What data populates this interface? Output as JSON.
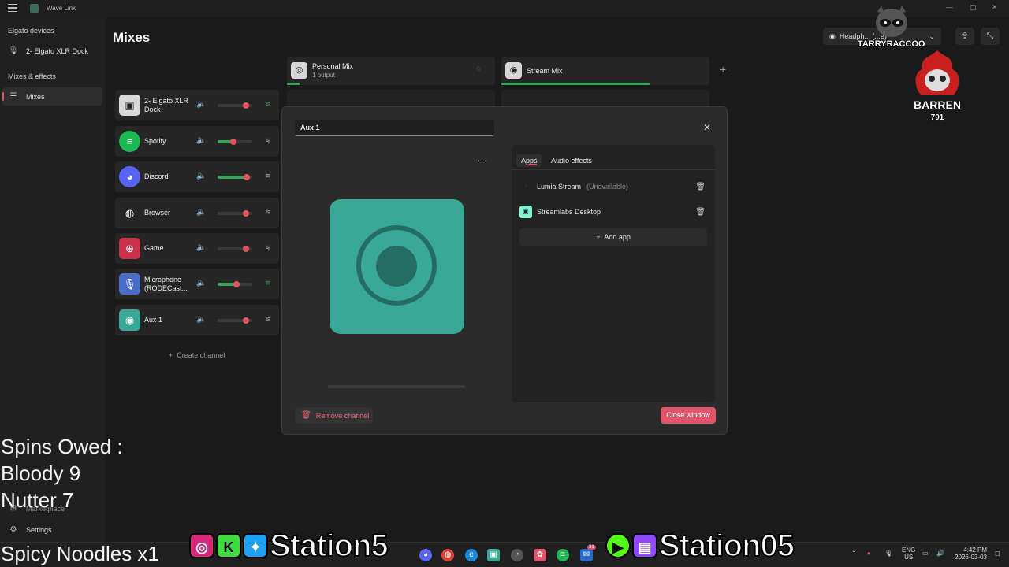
{
  "window": {
    "title": "Wave Link"
  },
  "sidebar": {
    "devices_heading": "Elgato devices",
    "device_item": "2- Elgato XLR Dock",
    "mixes_heading": "Mixes & effects",
    "mixes_item": "Mixes",
    "marketplace": "Marketplace",
    "settings": "Settings"
  },
  "main": {
    "title": "Mixes",
    "output_select": "Headph... (...e)",
    "mixes": [
      {
        "name": "Personal Mix",
        "sub": "1 output"
      },
      {
        "name": "Stream Mix",
        "sub": ""
      }
    ],
    "channels": [
      {
        "name": "2- Elgato XLR Dock",
        "level": 0.0
      },
      {
        "name": "Spotify",
        "level": 0.45
      },
      {
        "name": "Discord",
        "level": 0.85
      },
      {
        "name": "Browser",
        "level": 0.0
      },
      {
        "name": "Game",
        "level": 0.0
      },
      {
        "name": "Microphone (RODECast...",
        "level": 0.55
      },
      {
        "name": "Aux 1",
        "level": 0.0
      }
    ],
    "create_channel": "Create channel"
  },
  "modal": {
    "channel_name": "Aux 1",
    "more": "...",
    "tabs": [
      "Apps",
      "Audio effects"
    ],
    "apps": [
      {
        "name": "Lumia Stream",
        "status": "(Unavailable)"
      },
      {
        "name": "Streamlabs Desktop",
        "status": ""
      }
    ],
    "add_app": "Add app",
    "remove_channel": "Remove channel",
    "close_window": "Close window"
  },
  "overlay": {
    "spins_owed": "Spins Owed :",
    "bloody": "Bloody 9",
    "nutter": "Nutter 7",
    "spicy": "Spicy Noodles x1",
    "station_left": "Station5",
    "station_right": "Station05",
    "logo_top": "STARRYRACCOON",
    "logo_bottom_line1": "BARREN",
    "logo_bottom_line2": "791"
  },
  "taskbar": {
    "lang_line1": "ENG",
    "lang_line2": "US",
    "time": "4:42 PM",
    "date": "2026-03-03",
    "badge_count": "31"
  },
  "colors": {
    "accent": "#e0556a",
    "meter_green": "#3aa35a",
    "aux_teal": "#3aa896"
  }
}
